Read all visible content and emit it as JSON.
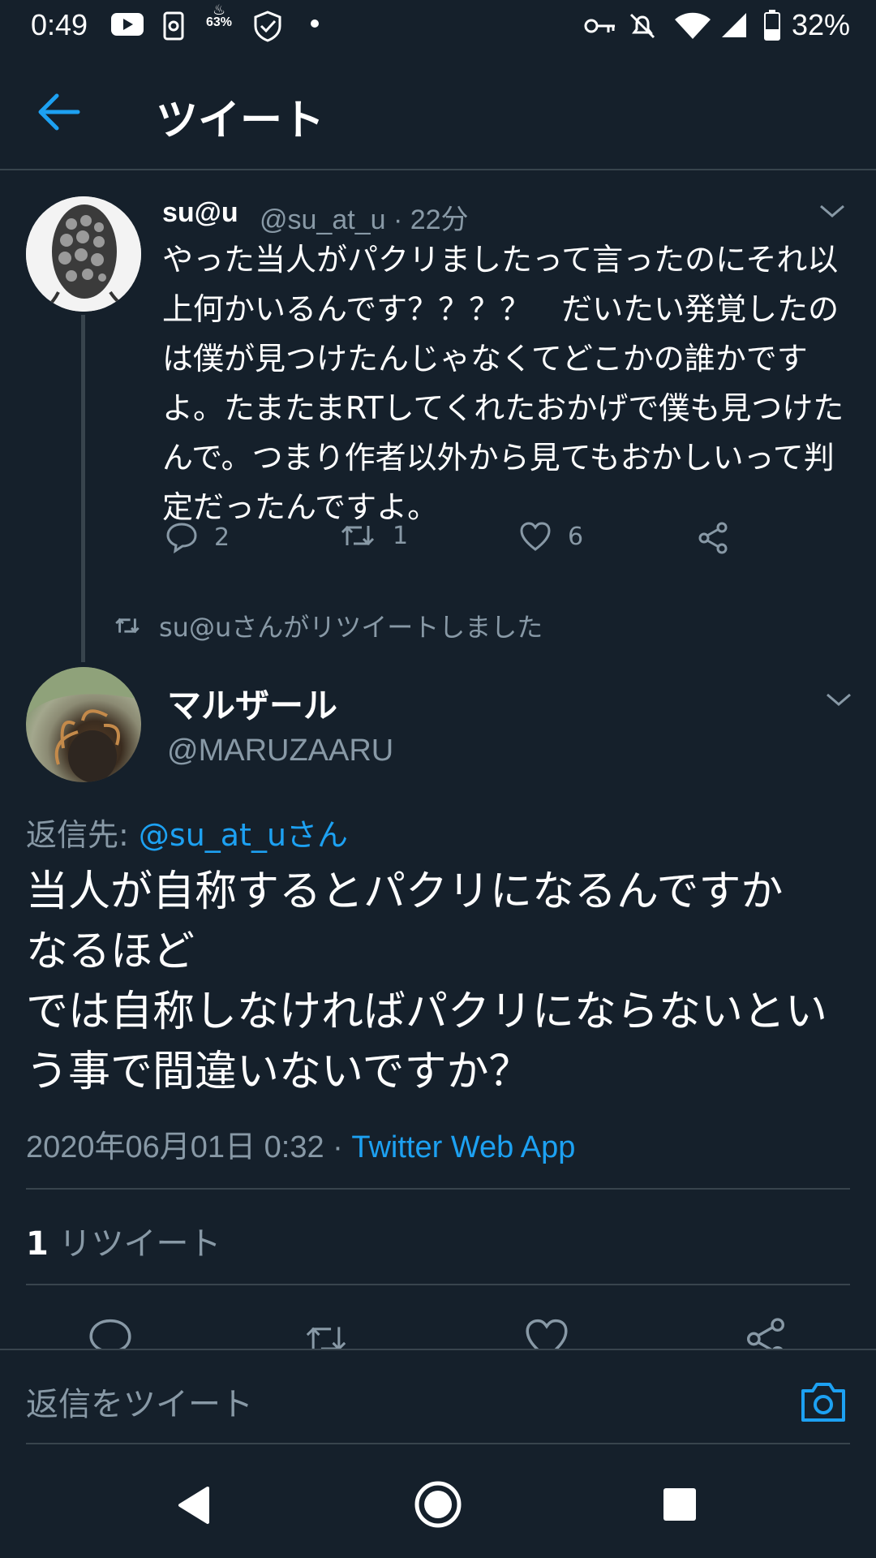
{
  "status_bar": {
    "time": "0:49",
    "small_badge": "63%",
    "battery": "32%"
  },
  "header": {
    "title": "ツイート"
  },
  "parent_tweet": {
    "name": "su@u",
    "handle_time": "@su_at_u · 22分",
    "text": "やった当人がパクリましたって言ったのにそれ以上何かいるんです？？？？　だいたい発覚したのは僕が見つけたんじゃなくてどこかの誰かですよ。たまたまRTしてくれたおかげで僕も見つけたんで。つまり作者以外から見てもおかしいって判定だったんですよ。",
    "reply_count": "2",
    "retweet_count": "1",
    "like_count": "6"
  },
  "retweet_notice": "su@uさんがリツイートしました",
  "main_tweet": {
    "name": "マルザール",
    "handle": "@MARUZAARU",
    "reply_to_label": "返信先: ",
    "reply_to_handle": "@su_at_uさん",
    "text": "当人が自称するとパクリになるんですか　なるほど\nでは自称しなければパクリにならないという事で間違いないですか？",
    "timestamp": "2020年06月01日 0:32 · ",
    "source": "Twitter Web App",
    "retweet_count": "1",
    "retweet_label": " リツイート"
  },
  "reply_bar": {
    "placeholder": "返信をツイート"
  },
  "colors": {
    "background": "#15202b",
    "accent": "#1da1f2",
    "secondary_text": "#8899a6",
    "divider": "#38444d"
  }
}
